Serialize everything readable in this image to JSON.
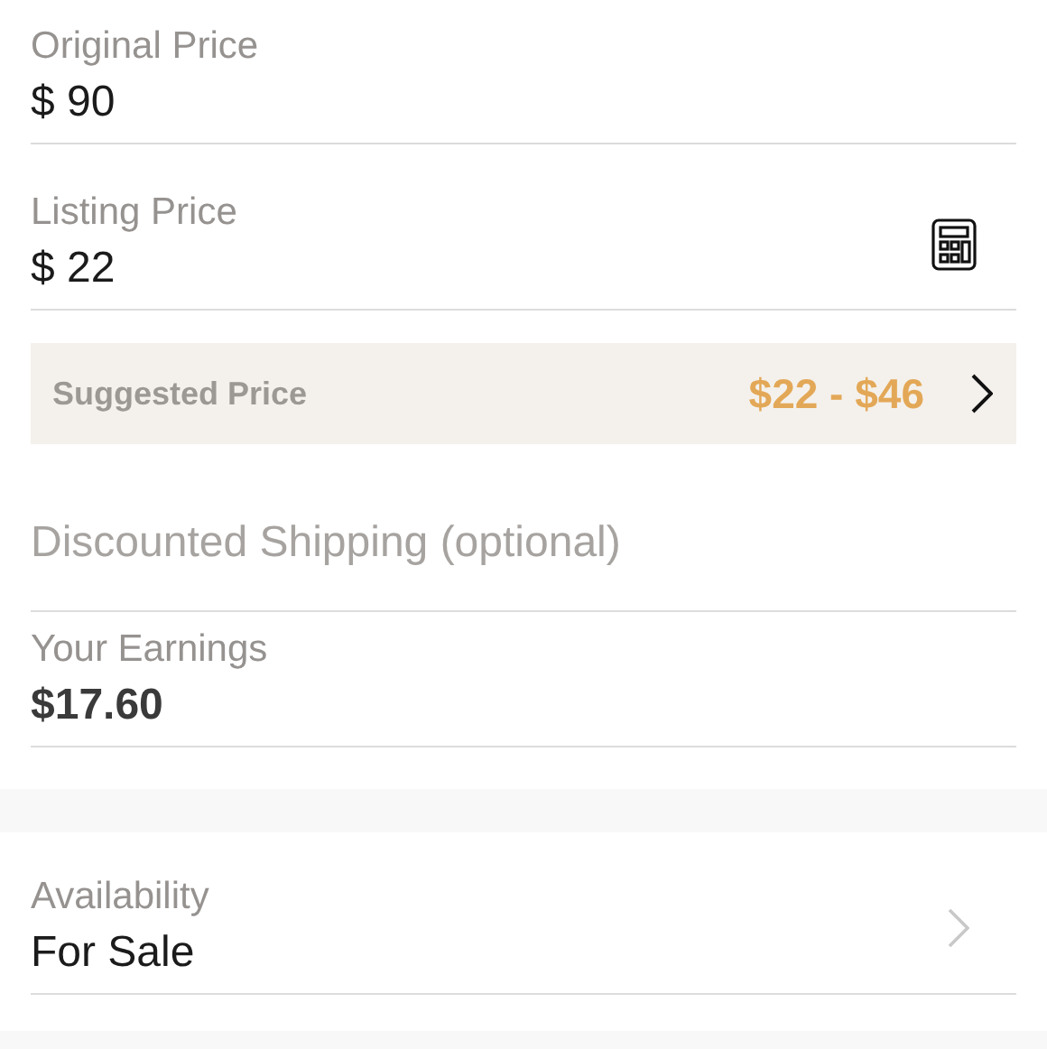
{
  "original_price": {
    "label": "Original Price",
    "value": "$ 90"
  },
  "listing_price": {
    "label": "Listing Price",
    "value": "$ 22",
    "calculator": true
  },
  "suggested_price": {
    "label": "Suggested Price",
    "range": "$22 - $46"
  },
  "discounted_shipping": {
    "placeholder": "Discounted Shipping (optional)"
  },
  "earnings": {
    "label": "Your Earnings",
    "value": "$17.60"
  },
  "availability": {
    "label": "Availability",
    "value": "For Sale"
  }
}
